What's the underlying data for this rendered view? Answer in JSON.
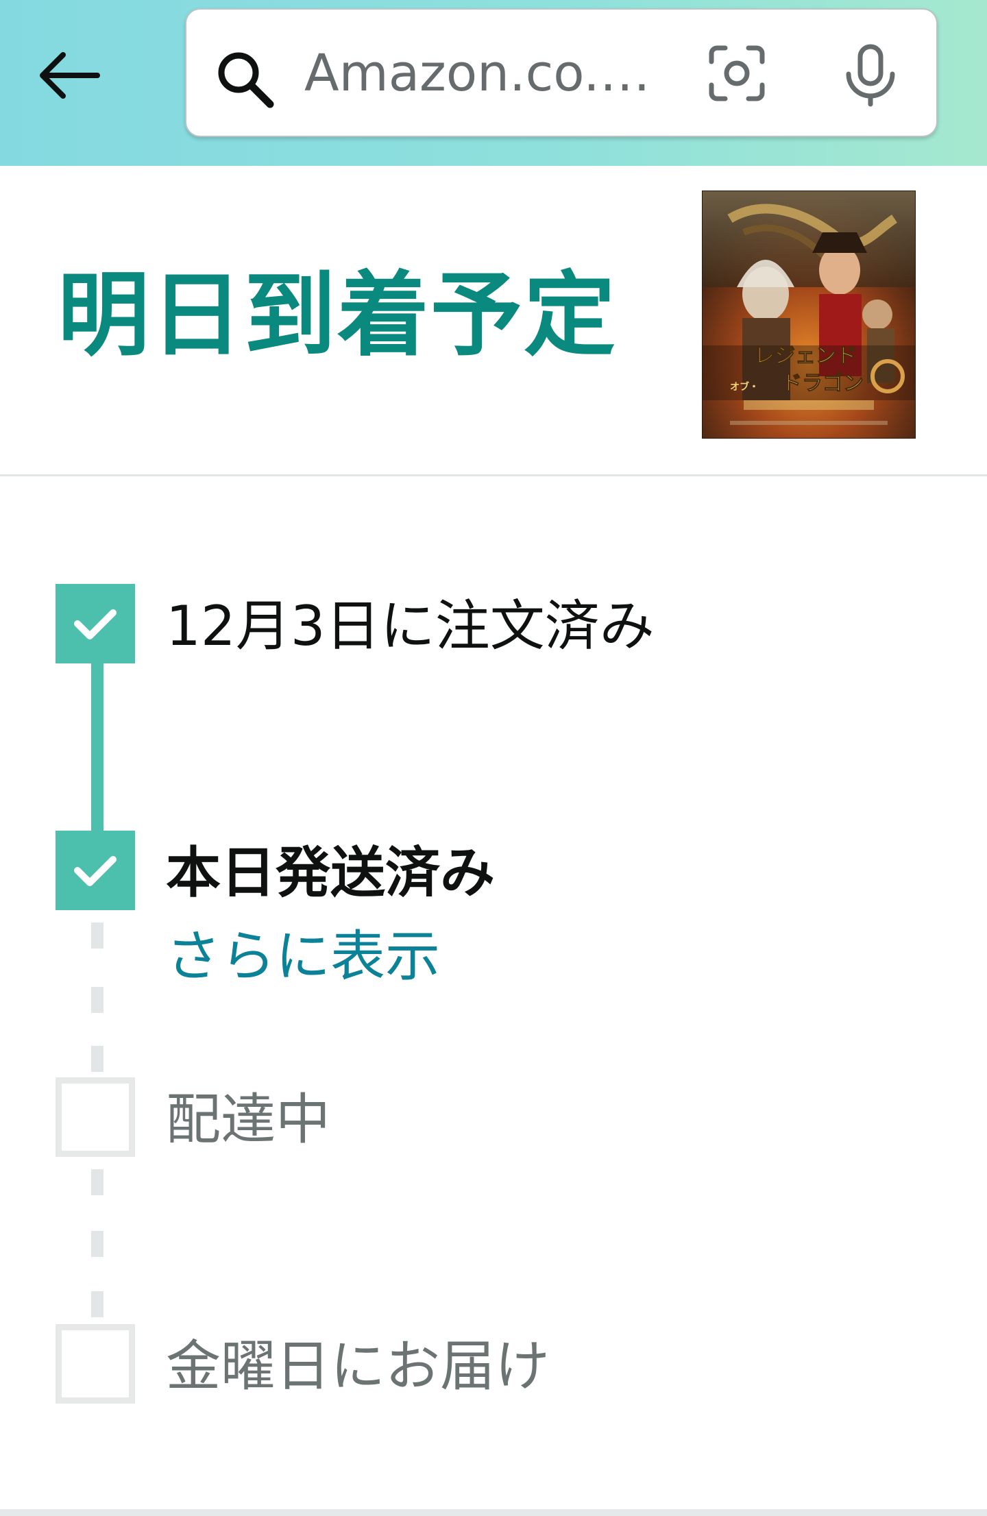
{
  "header": {
    "search_placeholder": "Amazon.co.…",
    "icons": [
      "back-arrow-icon",
      "search-icon",
      "camera-icon",
      "microphone-icon"
    ]
  },
  "arrival": {
    "title": "明日到着予定"
  },
  "product": {
    "thumbnail_text_line1": "レジェンド",
    "thumbnail_text_line2": "ドラゴン",
    "thumbnail_text_line3": "オブ・"
  },
  "tracking": {
    "steps": [
      {
        "label": "12月3日に注文済み",
        "status": "done"
      },
      {
        "label": "本日発送済み",
        "status": "done"
      },
      {
        "label": "配達中",
        "status": "pending"
      },
      {
        "label": "金曜日にお届け",
        "status": "pending"
      }
    ],
    "show_more": "さらに表示"
  },
  "colors": {
    "accent_teal": "#0a8a7f",
    "step_done": "#4dbfad",
    "step_pending_border": "#e7e8e8",
    "link": "#0c8299"
  }
}
